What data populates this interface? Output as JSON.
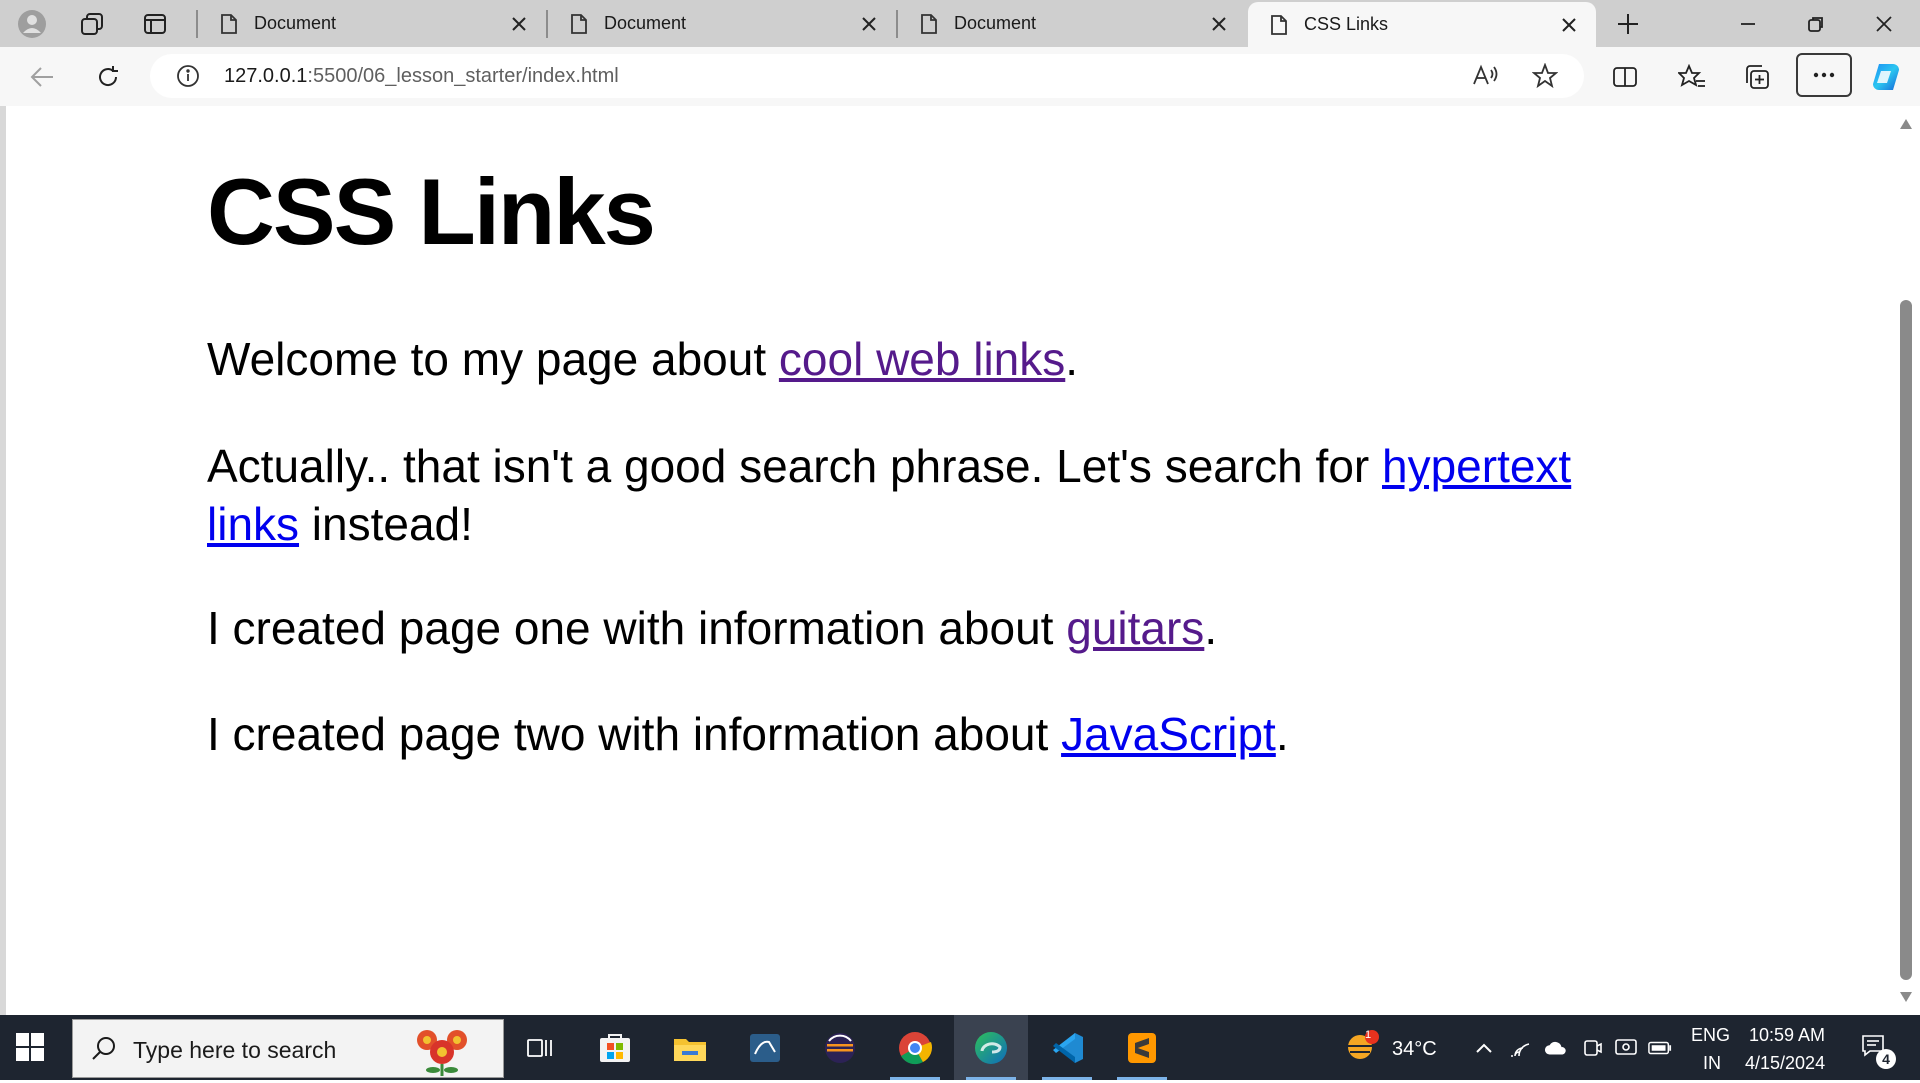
{
  "browser": {
    "tabs": [
      {
        "title": "Document",
        "active": false
      },
      {
        "title": "Document",
        "active": false
      },
      {
        "title": "Document",
        "active": false
      },
      {
        "title": "CSS Links",
        "active": true
      }
    ],
    "url_host": "127.0.0.1",
    "url_rest": ":5500/06_lesson_starter/index.html"
  },
  "page": {
    "heading": "CSS Links",
    "p1": {
      "before": "Welcome to my page about ",
      "link": "cool web links",
      "after": "."
    },
    "p2": {
      "before": "Actually.. that isn't a good search phrase. Let's search for ",
      "link": "hypertext links",
      "after": " instead!"
    },
    "p3": {
      "before": "I created page one with information about ",
      "link": "guitars",
      "after": "."
    },
    "p4": {
      "before": "I created page two with information about ",
      "link": "JavaScript",
      "after": "."
    }
  },
  "taskbar": {
    "search_placeholder": "Type here to search",
    "weather_temp": "34°C",
    "weather_badge": "1",
    "language": "ENG",
    "region": "IN",
    "time": "10:59 AM",
    "date": "4/15/2024",
    "notification_count": "4"
  },
  "colors": {
    "visited_link": "#551a8b",
    "unvisited_link": "#0000ee",
    "taskbar_bg": "#1e2530"
  }
}
